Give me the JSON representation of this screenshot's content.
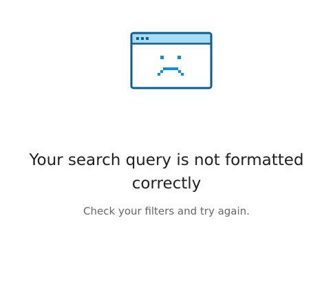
{
  "error": {
    "icon": "sad-browser-window-icon",
    "headline": "Your search query is not formatted correctly",
    "message": "Check your filters and try again."
  },
  "colors": {
    "icon_stroke": "#0a5e8f",
    "icon_titlebar": "#a8dcf5",
    "icon_face": "#0a8ed9",
    "headline": "#1f1f1f",
    "message": "#666666",
    "background": "#ffffff"
  }
}
